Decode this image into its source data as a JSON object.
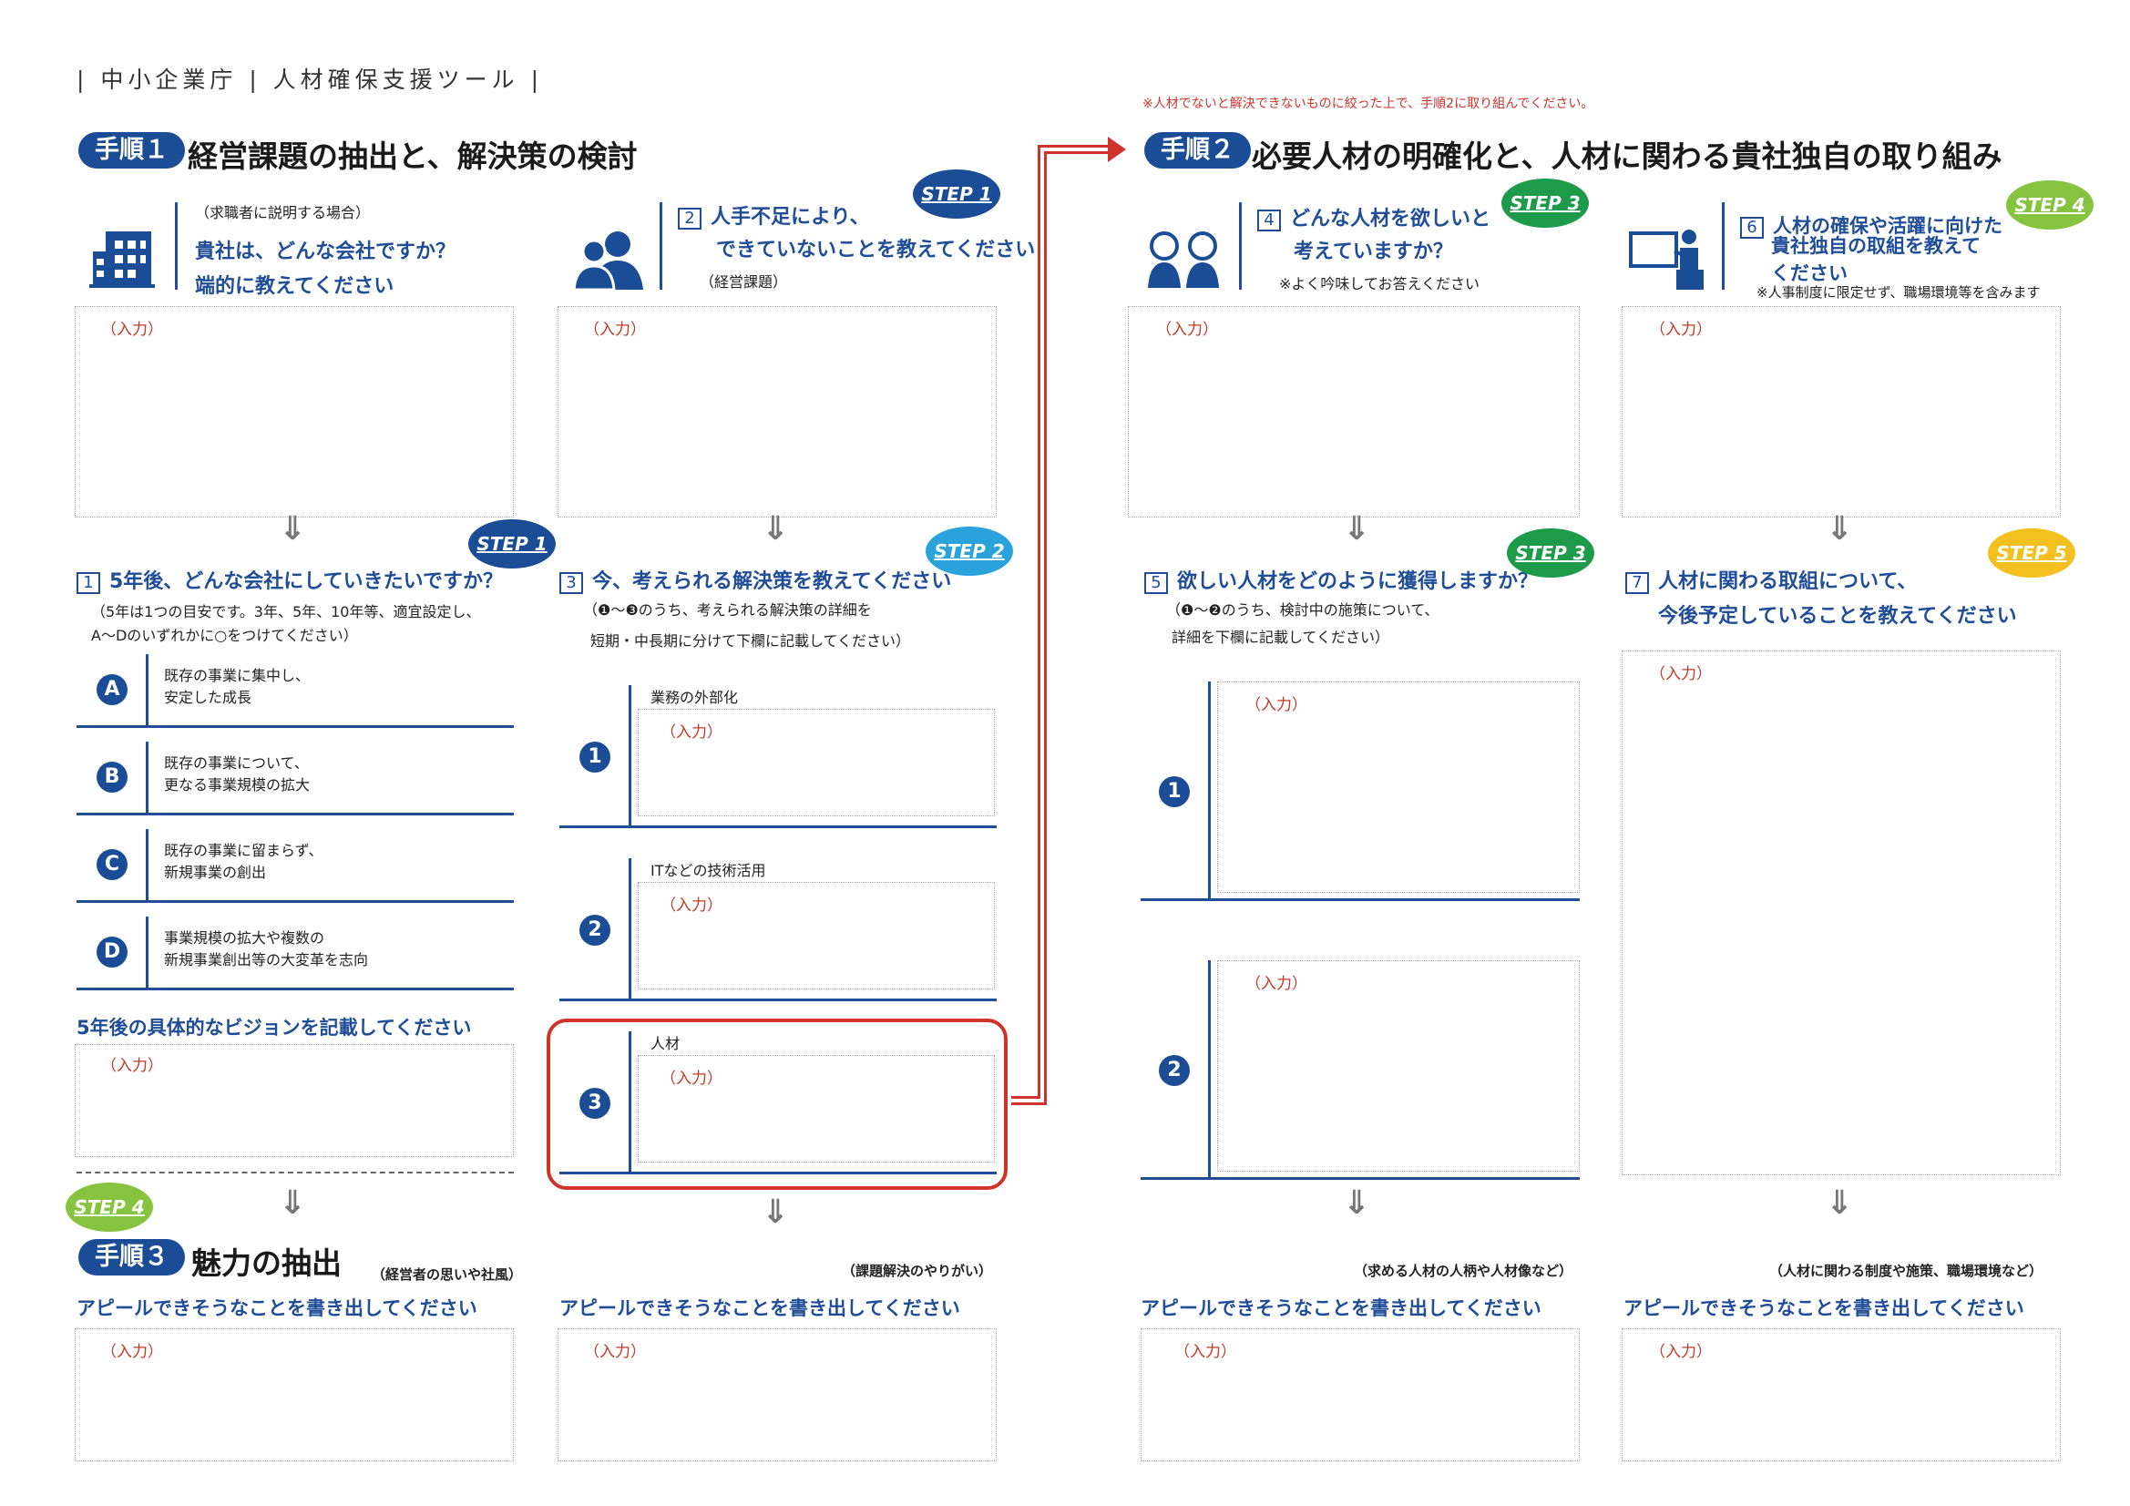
{
  "header": {
    "title": "| 中小企業庁 | 人材確保支援ツール |"
  },
  "red_note": "※人材でないと解決できないものに絞った上で、手順2に取り組んでください。",
  "input_placeholder": "（入力）",
  "proc1": {
    "badge": "手順１",
    "title": "経営課題の抽出と、解決策の検討"
  },
  "proc2": {
    "badge": "手順２",
    "title": "必要人材の明確化と、人材に関わる貴社独自の取り組み"
  },
  "proc3": {
    "badge": "手順３",
    "title": "魅力の抽出",
    "note": "（経営者の思いや社風）"
  },
  "q_company": {
    "note": "（求職者に説明する場合）",
    "line1": "貴社は、どんな会社ですか？",
    "line2": "端的に教えてください"
  },
  "q2": {
    "num": "2",
    "line1": "人手不足により、",
    "line2": "できていないことを教えてください",
    "note": "（経営課題）"
  },
  "q4": {
    "num": "4",
    "line1": "どんな人材を欲しいと",
    "line2": "考えていますか？",
    "note": "※よく吟味してお答えください"
  },
  "q6": {
    "num": "6",
    "line1": "人材の確保や活躍に向けた",
    "line2": "貴社独自の取組を教えて",
    "line3": "ください",
    "note": "※人事制度に限定せず、職場環境等を含みます"
  },
  "q1": {
    "num": "1",
    "title": "5年後、どんな会社にしていきたいですか？",
    "note1": "（5年は1つの目安です。3年、5年、10年等、適宜設定し、",
    "note2": "A～Dのいずれかに○をつけてください）"
  },
  "q3": {
    "num": "3",
    "title": "今、考えられる解決策を教えてください",
    "note1": "（❶～❸のうち、考えられる解決策の詳細を",
    "note2": "短期・中長期に分けて下欄に記載してください）"
  },
  "q5": {
    "num": "5",
    "title": "欲しい人材をどのように獲得しますか？",
    "note1": "（❶～❷のうち、検討中の施策について、",
    "note2": "詳細を下欄に記載してください）"
  },
  "q7": {
    "num": "7",
    "line1": "人材に関わる取組について、",
    "line2": "今後予定していることを教えてください"
  },
  "options": [
    {
      "letter": "A",
      "line1": "既存の事業に集中し、",
      "line2": "安定した成長"
    },
    {
      "letter": "B",
      "line1": "既存の事業について、",
      "line2": "更なる事業規模の拡大"
    },
    {
      "letter": "C",
      "line1": "既存の事業に留まらず、",
      "line2": "新規事業の創出"
    },
    {
      "letter": "D",
      "line1": "事業規模の拡大や複数の",
      "line2": "新規事業創出等の大変革を志向"
    }
  ],
  "solutions": [
    {
      "num": "1",
      "label": "業務の外部化"
    },
    {
      "num": "2",
      "label": "ITなどの技術活用"
    },
    {
      "num": "3",
      "label": "人材"
    }
  ],
  "acquire": [
    {
      "num": "1"
    },
    {
      "num": "2"
    }
  ],
  "vision_prompt": "5年後の具体的なビジョンを記載してください",
  "appeal_prompt": "アピールできそうなことを書き出してください",
  "appeal_notes": {
    "col2": "（課題解決のやりがい）",
    "col3": "（求める人材の人柄や人材像など）",
    "col4": "（人材に関わる制度や施策、職場環境など）"
  },
  "steps": {
    "s1": "STEP 1",
    "s2": "STEP 2",
    "s3": "STEP 3",
    "s4": "STEP 4",
    "s5": "STEP 5"
  },
  "colors": {
    "navy": "#1a4d95",
    "red": "#d0322c",
    "step2": "#2aa3dd",
    "step3": "#1e9a4b",
    "step4": "#86c440",
    "step5": "#f4c020"
  }
}
